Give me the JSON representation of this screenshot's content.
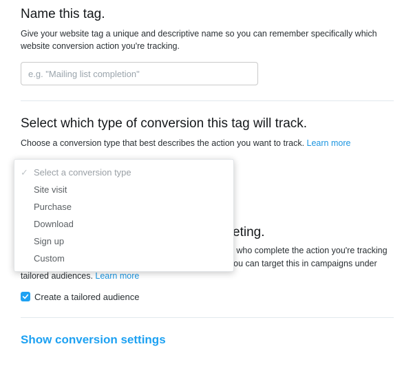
{
  "section1": {
    "title": "Name this tag.",
    "desc": "Give your website tag a unique and descriptive name so you can remember specifically which website conversion action you're tracking.",
    "placeholder": "e.g. \"Mailing list completion\""
  },
  "section2": {
    "title": "Select which type of conversion this tag will track.",
    "desc": "Choose a conversion type that best describes the action you want to track. ",
    "learn_more": "Learn more",
    "dropdown": {
      "placeholder": "Select a conversion type",
      "options": [
        "Site visit",
        "Purchase",
        "Download",
        "Sign up",
        "Custom"
      ]
    }
  },
  "section3": {
    "title_suffix": "eting.",
    "desc_p1": "Create a tailored audience composed of website visitors who complete the action you're tracking — for example, website visitors who made purchases. You can target this in campaigns under tailored audiences. ",
    "learn_more": "Learn more",
    "checkbox_label": "Create a tailored audience"
  },
  "footer": {
    "show_settings": "Show conversion settings"
  }
}
